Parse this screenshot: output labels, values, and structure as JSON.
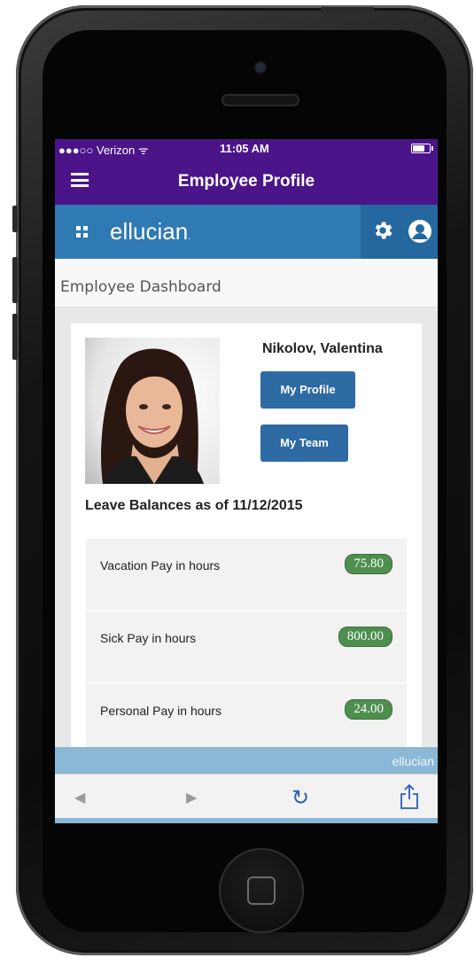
{
  "status_bar": {
    "carrier": "●●●○○ Verizon ᯤ",
    "time": "11:05 AM"
  },
  "header": {
    "title": "Employee Profile"
  },
  "brand_bar": {
    "logo_text": "ellucian",
    "logo_suffix": "."
  },
  "dashboard": {
    "title": "Employee Dashboard"
  },
  "profile": {
    "name": "Nikolov, Valentina",
    "my_profile_label": "My Profile",
    "my_team_label": "My Team"
  },
  "leave": {
    "title": "Leave Balances as of 11/12/2015",
    "items": [
      {
        "label": "Vacation Pay in hours",
        "value": "75.80"
      },
      {
        "label": "Sick Pay in hours",
        "value": "800.00"
      },
      {
        "label": "Personal Pay in hours",
        "value": "24.00"
      }
    ]
  },
  "footer": {
    "logo_text": "ellucian"
  },
  "browser": {
    "back_icon": "◀",
    "forward_icon": "▶",
    "reload_icon": "↻"
  },
  "colors": {
    "purple": "#4b1589",
    "ellucian_blue": "#2f7ab3",
    "button_blue": "#2e6aa3",
    "badge_green": "#4e8e4e"
  }
}
